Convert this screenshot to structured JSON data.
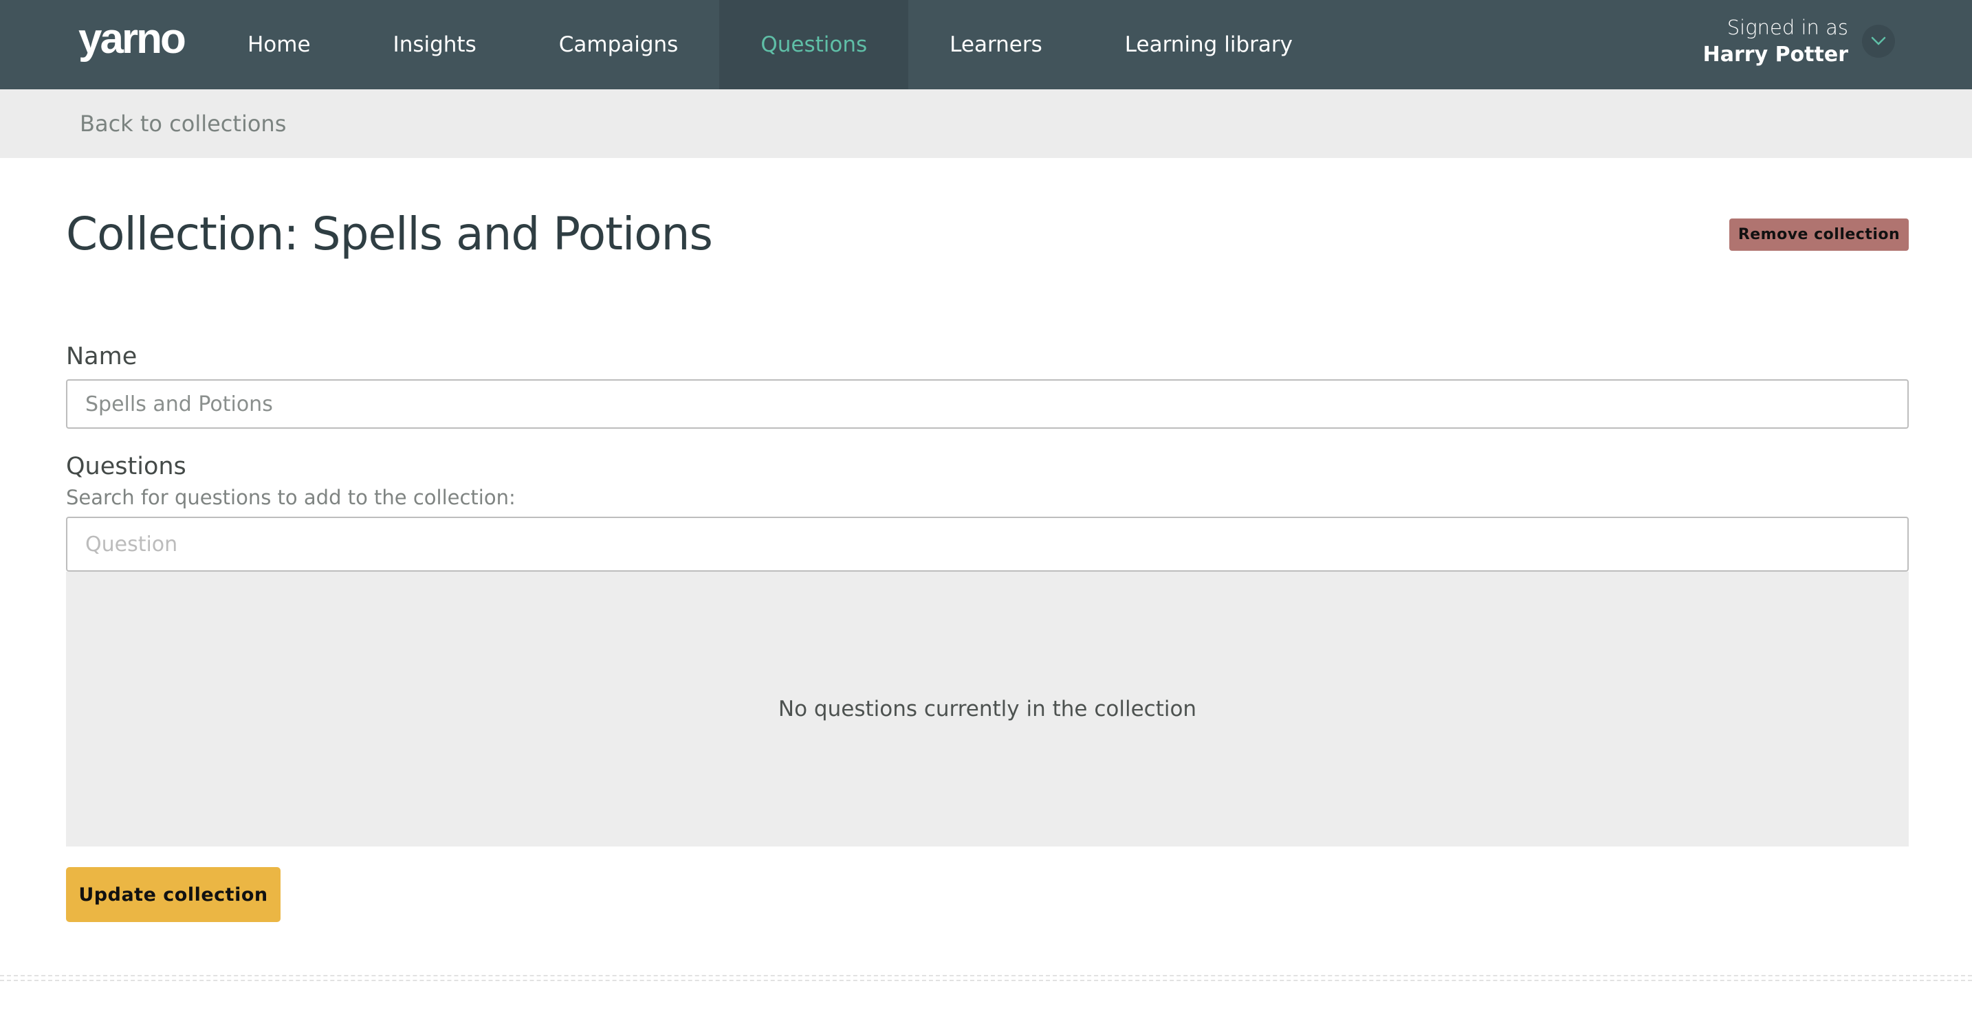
{
  "header": {
    "logo": "yarno",
    "nav": [
      {
        "label": "Home",
        "active": false
      },
      {
        "label": "Insights",
        "active": false
      },
      {
        "label": "Campaigns",
        "active": false
      },
      {
        "label": "Questions",
        "active": true
      },
      {
        "label": "Learners",
        "active": false
      },
      {
        "label": "Learning library",
        "active": false
      }
    ],
    "user": {
      "signed_in_label": "Signed in as",
      "name": "Harry Potter",
      "menu_icon": "chevron-down-icon"
    }
  },
  "subnav": {
    "back_link": "Back to collections"
  },
  "page": {
    "title": "Collection: Spells and Potions",
    "remove_button": "Remove collection"
  },
  "form": {
    "name_label": "Name",
    "name_value": "Spells and Potions",
    "questions_label": "Questions",
    "questions_help": "Search for questions to add to the collection:",
    "question_placeholder": "Question",
    "question_value": "",
    "empty_message": "No questions currently in the collection",
    "submit_button": "Update collection"
  },
  "colors": {
    "header_bg": "#42545b",
    "active_nav_bg": "#3a4a51",
    "accent": "#5fbfa7",
    "remove_button": "#b07470",
    "update_button": "#ebb644",
    "title": "#2f3e43"
  }
}
